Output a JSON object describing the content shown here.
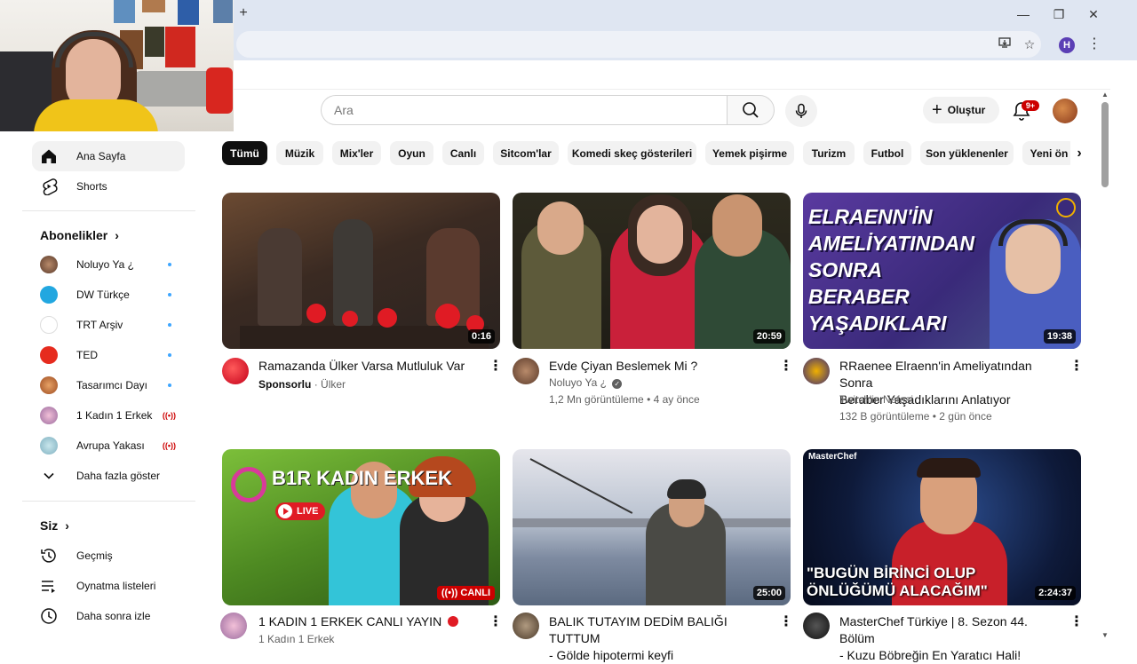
{
  "browser": {
    "new_tab_label": "+",
    "minimize_label": "—",
    "restore_label": "❐",
    "close_label": "✕",
    "profile_initial": "H"
  },
  "header": {
    "search_placeholder": "Ara",
    "create_label": "Oluştur",
    "notification_count": "9+"
  },
  "sidebar": {
    "main": [
      {
        "label": "Ana Sayfa",
        "icon": "home-icon",
        "active": true
      },
      {
        "label": "Shorts",
        "icon": "shorts-icon",
        "active": false
      }
    ],
    "subscriptions_heading": "Abonelikler",
    "subscriptions": [
      {
        "label": "Noluyo Ya ¿",
        "indicator": "new"
      },
      {
        "label": "DW Türkçe",
        "indicator": "new"
      },
      {
        "label": "TRT Arşiv",
        "indicator": "new"
      },
      {
        "label": "TED",
        "indicator": "new"
      },
      {
        "label": "Tasarımcı Dayı",
        "indicator": "new"
      },
      {
        "label": "1 Kadın 1 Erkek",
        "indicator": "live"
      },
      {
        "label": "Avrupa Yakası",
        "indicator": "live"
      }
    ],
    "show_more_label": "Daha fazla göster",
    "you_heading": "Siz",
    "you_items": [
      {
        "label": "Geçmiş",
        "icon": "history-icon"
      },
      {
        "label": "Oynatma listeleri",
        "icon": "playlist-icon"
      },
      {
        "label": "Daha sonra izle",
        "icon": "watch-later-icon"
      }
    ]
  },
  "chips": [
    "Tümü",
    "Müzik",
    "Mix'ler",
    "Oyun",
    "Canlı",
    "Sitcom'lar",
    "Komedi skeç gösterileri",
    "Yemek pişirme",
    "Turizm",
    "Futbol",
    "Son yüklenenler",
    "Yeni ön"
  ],
  "videos": [
    {
      "title": "Ramazanda Ülker Varsa Mutluluk Var",
      "title2": "",
      "channel": "Ülker",
      "sponsor": "Sponsorlu",
      "meta": "",
      "duration": "0:16",
      "live": false,
      "verified": false
    },
    {
      "title": "Evde Çiyan Beslemek Mi ?",
      "title2": "",
      "channel": "Noluyo Ya ¿",
      "sponsor": "",
      "meta": "1,2 Mn görüntüleme • 4 ay önce",
      "duration": "20:59",
      "live": false,
      "verified": true
    },
    {
      "title": "RRaenee Elraenn'in Ameliyatından Sonra",
      "title2": "Beraber Yaşadıklarını Anlatıyor",
      "channel": "Twitch'in Nefesi",
      "sponsor": "",
      "meta": "132 B görüntüleme • 2 gün önce",
      "duration": "19:38",
      "live": false,
      "verified": false,
      "thumb_text": [
        "ELRAENN'İN",
        "AMELİYATINDAN",
        "SONRA",
        "BERABER",
        "YAŞADIKLARI"
      ]
    },
    {
      "title": "1 KADIN 1 ERKEK CANLI YAYIN",
      "title2": "",
      "channel": "1 Kadın 1 Erkek",
      "sponsor": "",
      "meta": "",
      "duration": "CANLI",
      "live": true,
      "verified": false,
      "thumb_logo": "B1R KADIN ERKEK",
      "thumb_live": "LIVE"
    },
    {
      "title": "BALIK TUTAYIM DEDİM BALIĞI TUTTUM",
      "title2": "- Gölde hipotermi keyfi",
      "channel": "",
      "sponsor": "",
      "meta": "",
      "duration": "25:00",
      "live": false,
      "verified": false
    },
    {
      "title": "MasterChef Türkiye | 8. Sezon 44. Bölüm",
      "title2": "- Kuzu Böbreğin En Yaratıcı Hali!",
      "channel": "",
      "sponsor": "",
      "meta": "",
      "duration": "2:24:37",
      "live": false,
      "verified": false,
      "thumb_badge": "MasterChef",
      "thumb_quote": [
        "\"BUGÜN BİRİNCİ OLUP",
        "ÖNLÜĞÜMÜ ALACAĞIM\""
      ]
    }
  ]
}
